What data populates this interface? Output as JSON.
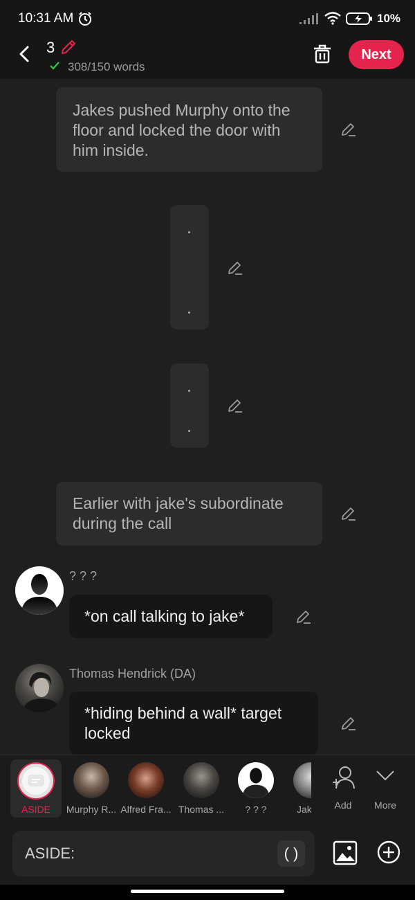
{
  "status_bar": {
    "time": "10:31 AM",
    "battery": "10%"
  },
  "header": {
    "count": "3",
    "word_count": "308/150 words",
    "next_label": "Next"
  },
  "narration": [
    {
      "text": "Jakes pushed Murphy onto the floor and locked the door with him inside."
    },
    {
      "text": "Earlier with jake's subordinate during the call"
    }
  ],
  "messages": [
    {
      "sender": "? ? ?",
      "text": "*on call talking to jake*"
    },
    {
      "sender": "Thomas Hendrick (DA)",
      "text": "*hiding behind a wall* target locked"
    }
  ],
  "characters": {
    "aside_label": "ASIDE",
    "items": [
      {
        "label": "Murphy R..."
      },
      {
        "label": "Alfred Fra..."
      },
      {
        "label": "Thomas ..."
      },
      {
        "label": "? ? ?"
      },
      {
        "label": "Jake F"
      }
    ],
    "add_label": "Add",
    "more_label": "More"
  },
  "input": {
    "prefix": "ASIDE:",
    "paren_label": "( )"
  },
  "colors": {
    "accent": "#e5244d",
    "background": "#1f1f1f",
    "bubble": "#2c2c2c",
    "check": "#2ecc40"
  }
}
